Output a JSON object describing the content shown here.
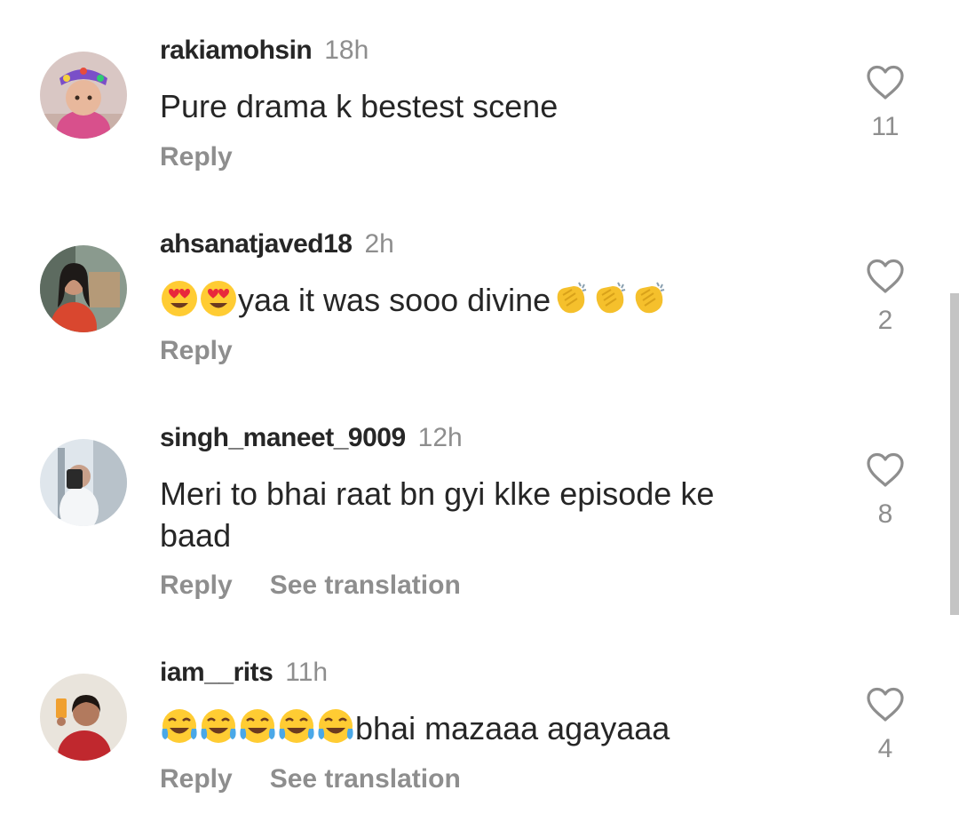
{
  "comments": [
    {
      "username": "rakiamohsin",
      "time": "18h",
      "text_before": "Pure drama k bestest scene",
      "text_after": "",
      "likes": "11",
      "reply": "Reply",
      "translate": ""
    },
    {
      "username": "ahsanatjaved18",
      "time": "2h",
      "text_before": "",
      "text_after": "yaa it was sooo divine",
      "emoji_before": [
        "heart-eyes",
        "heart-eyes"
      ],
      "emoji_after": [
        "clapping-hands",
        "clapping-hands",
        "clapping-hands"
      ],
      "likes": "2",
      "reply": "Reply",
      "translate": ""
    },
    {
      "username": "singh_maneet_9009",
      "time": "12h",
      "text_before": "Meri to bhai raat bn gyi klke episode ke baad",
      "text_after": "",
      "likes": "8",
      "reply": "Reply",
      "translate": "See translation"
    },
    {
      "username": "iam__rits",
      "time": "11h",
      "text_before": "",
      "text_after": "bhai mazaaa agayaaa",
      "emoji_before": [
        "tears-of-joy",
        "tears-of-joy",
        "tears-of-joy",
        "tears-of-joy",
        "tears-of-joy"
      ],
      "likes": "4",
      "reply": "Reply",
      "translate": "See translation"
    }
  ],
  "colors": {
    "primary_text": "#262626",
    "secondary_text": "#8e8e8e",
    "background": "#ffffff"
  }
}
